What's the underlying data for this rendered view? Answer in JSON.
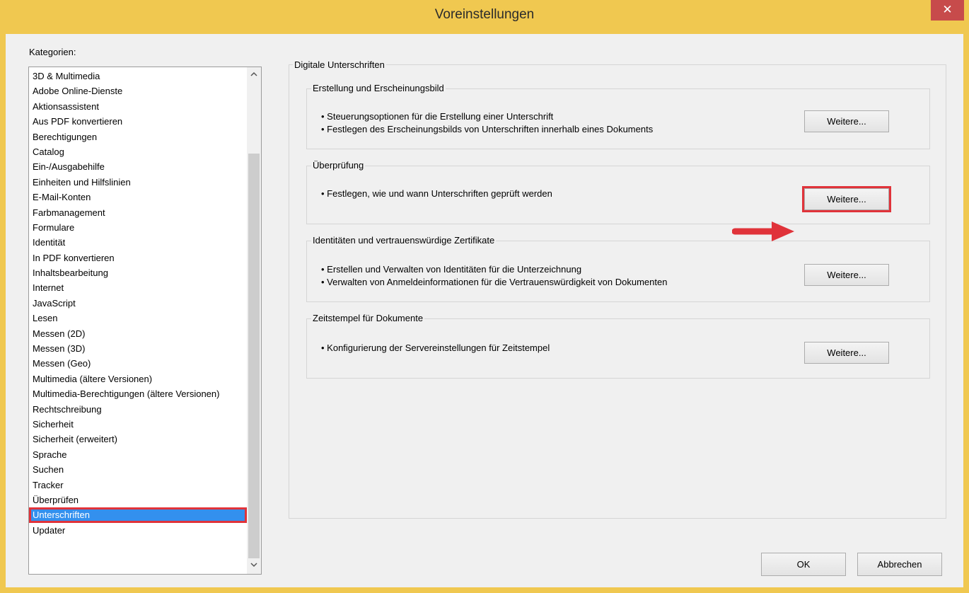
{
  "window": {
    "title": "Voreinstellungen",
    "close_label": "✕",
    "colors": {
      "frame": "#f0c850",
      "close": "#c74b4b",
      "selection": "#3390ee",
      "highlight": "#e0333a"
    }
  },
  "categories": {
    "label": "Kategorien:",
    "items": [
      "3D & Multimedia",
      "Adobe Online-Dienste",
      "Aktionsassistent",
      "Aus PDF konvertieren",
      "Berechtigungen",
      "Catalog",
      "Ein-/Ausgabehilfe",
      "Einheiten und Hilfslinien",
      "E-Mail-Konten",
      "Farbmanagement",
      "Formulare",
      "Identität",
      "In PDF konvertieren",
      "Inhaltsbearbeitung",
      "Internet",
      "JavaScript",
      "Lesen",
      "Messen (2D)",
      "Messen (3D)",
      "Messen (Geo)",
      "Multimedia (ältere Versionen)",
      "Multimedia-Berechtigungen (ältere Versionen)",
      "Rechtschreibung",
      "Sicherheit",
      "Sicherheit (erweitert)",
      "Sprache",
      "Suchen",
      "Tracker",
      "Überprüfen",
      "Unterschriften",
      "Updater"
    ],
    "selected": "Unterschriften",
    "scroll_up_icon": "chevron-up-icon",
    "scroll_down_icon": "chevron-down-icon"
  },
  "main": {
    "title": "Digitale Unterschriften",
    "sections": [
      {
        "title": "Erstellung und Erscheinungsbild",
        "bullets": [
          "• Steuerungsoptionen für die Erstellung einer Unterschrift",
          "• Festlegen des Erscheinungsbilds von Unterschriften innerhalb eines Dokuments"
        ],
        "button": "Weitere..."
      },
      {
        "title": "Überprüfung",
        "bullets": [
          "• Festlegen, wie und wann Unterschriften geprüft werden"
        ],
        "button": "Weitere..."
      },
      {
        "title": "Identitäten und vertrauenswürdige Zertifikate",
        "bullets": [
          "• Erstellen und Verwalten von Identitäten für die Unterzeichnung",
          "• Verwalten von Anmeldeinformationen für die Vertrauenswürdigkeit von Dokumenten"
        ],
        "button": "Weitere..."
      },
      {
        "title": "Zeitstempel für Dokumente",
        "bullets": [
          "• Konfigurierung der Servereinstellungen für Zeitstempel"
        ],
        "button": "Weitere..."
      }
    ]
  },
  "footer": {
    "ok_label": "OK",
    "cancel_label": "Abbrechen"
  }
}
